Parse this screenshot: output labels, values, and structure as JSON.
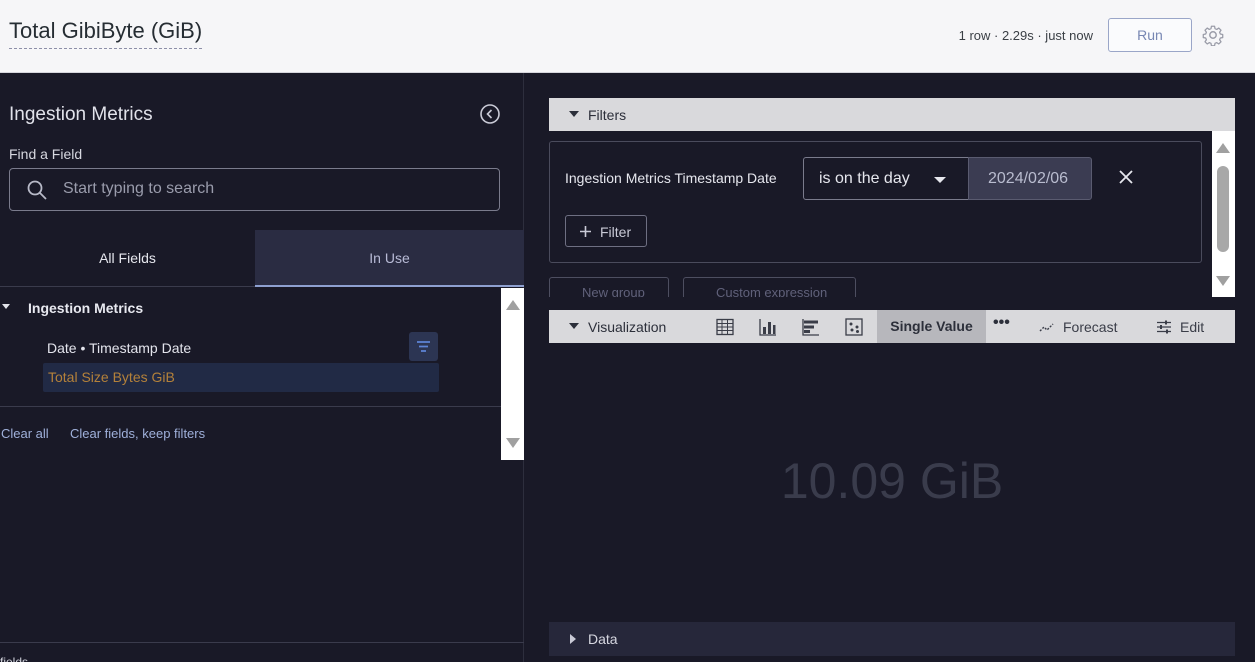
{
  "header": {
    "title": "Total GibiByte (GiB)",
    "meta": "1 row · 2.29s · just now",
    "run_label": "Run"
  },
  "sidebar": {
    "explore_name": "Ingestion Metrics",
    "find_label": "Find a Field",
    "search_placeholder": "Start typing to search",
    "tabs": [
      {
        "label": "All Fields",
        "active": false
      },
      {
        "label": "In Use",
        "active": true
      }
    ],
    "group": {
      "name": "Ingestion Metrics",
      "fields": [
        {
          "label": "Date • Timestamp Date",
          "filtered": true
        },
        {
          "label": "Total Size Bytes GiB",
          "selected": true
        }
      ]
    },
    "clear_all": "Clear all",
    "clear_keep": "Clear fields, keep filters",
    "bottom_text": "fields"
  },
  "filters": {
    "label": "Filters",
    "items": [
      {
        "field": "Ingestion Metrics Timestamp Date",
        "operator": "is on the day",
        "value": "2024/02/06"
      }
    ],
    "add_filter_label": "Filter",
    "new_group_label": "New group",
    "custom_expression_label": "Custom expression"
  },
  "visualization": {
    "label": "Visualization",
    "icons": [
      "table-icon",
      "column-chart-icon",
      "bar-chart-icon",
      "scatter-icon"
    ],
    "selected_type": "Single Value",
    "forecast_label": "Forecast",
    "edit_label": "Edit",
    "value": "10.09 GiB"
  },
  "data_section": {
    "label": "Data"
  },
  "colors": {
    "background": "#191927",
    "accent": "#8ea0d0",
    "selected_field_text": "#b4813a"
  }
}
